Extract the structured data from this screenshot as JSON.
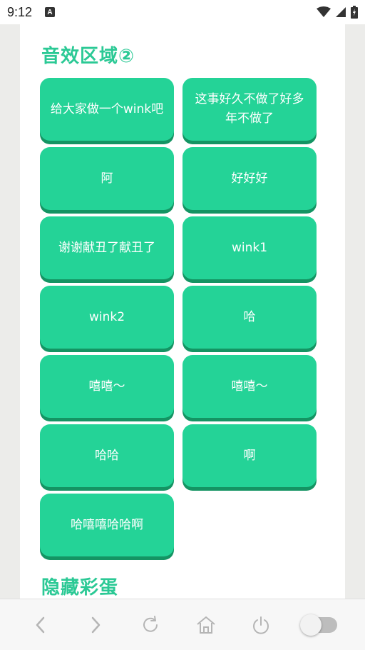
{
  "status_bar": {
    "time": "9:12",
    "a_badge": "A"
  },
  "section1": {
    "title": "音效区域②"
  },
  "buttons": [
    "给大家做一个wink吧",
    "这事好久不做了好多年不做了",
    "阿",
    "好好好",
    "谢谢献丑了献丑了",
    "wink1",
    "wink2",
    "哈",
    "嘻嘻～",
    "嘻嘻～",
    "哈哈",
    "啊",
    "哈嘻嘻哈哈啊"
  ],
  "section2": {
    "title": "隐藏彩蛋"
  },
  "colors": {
    "accent": "#24d397",
    "accent_shadow": "#149463",
    "title": "#2bc995"
  },
  "nav": {
    "icons": [
      "back-icon",
      "forward-icon",
      "refresh-icon",
      "home-icon",
      "power-icon",
      "toggle-switch"
    ]
  }
}
